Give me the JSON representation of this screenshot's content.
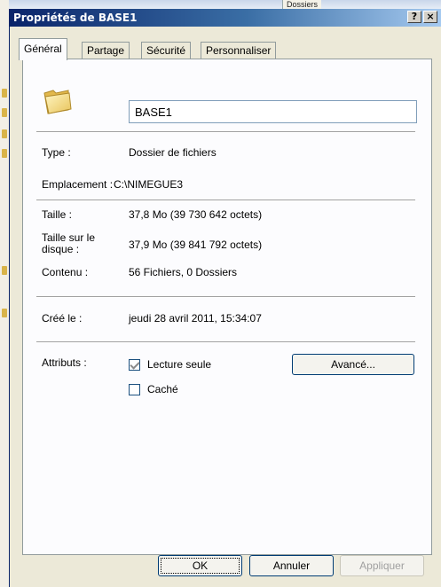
{
  "background": {
    "caption_fragment": "Dossiers"
  },
  "dialog": {
    "title": "Propriétés de BASE1",
    "help_button": "?",
    "close_button": "×",
    "tabs": [
      {
        "label": "Général",
        "active": true
      },
      {
        "label": "Partage",
        "active": false
      },
      {
        "label": "Sécurité",
        "active": false
      },
      {
        "label": "Personnaliser",
        "active": false
      }
    ],
    "folder_icon": "folder-icon",
    "name_value": "BASE1",
    "properties": {
      "type_label": "Type :",
      "type_value": "Dossier de fichiers",
      "location_label": "Emplacement :",
      "location_value": "C:\\NIMEGUE3",
      "size_label": "Taille :",
      "size_value": "37,8 Mo (39 730 642 octets)",
      "disk_size_label_1": "Taille sur le",
      "disk_size_label_2": "disque :",
      "disk_size_value": "37,9 Mo (39 841 792 octets)",
      "contents_label": "Contenu :",
      "contents_value": "56 Fichiers, 0 Dossiers",
      "created_label": "Créé le :",
      "created_value": "jeudi 28 avril 2011, 15:34:07",
      "attributes_label": "Attributs :"
    },
    "attributes": {
      "readonly_label": "Lecture seule",
      "readonly_checked": true,
      "hidden_label": "Caché",
      "hidden_checked": false,
      "advanced_button": "Avancé..."
    },
    "buttons": {
      "ok": "OK",
      "cancel": "Annuler",
      "apply": "Appliquer"
    },
    "colors": {
      "title_start": "#0a246a",
      "title_end": "#a6caf0",
      "dialog_bg": "#ece9d8",
      "panel_bg": "#fcfcfe"
    }
  }
}
